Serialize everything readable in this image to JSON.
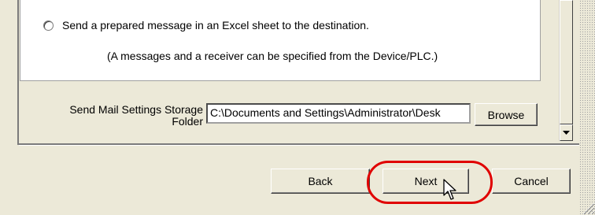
{
  "option": {
    "label": "Send a prepared message in an Excel sheet to the destination.",
    "note": "(A messages and a receiver can be specified from the Device/PLC.)"
  },
  "folder": {
    "label_line1": "Send Mail Settings Storage",
    "label_line2": "Folder",
    "value": "C:\\Documents and Settings\\Administrator\\Desk",
    "browse_label": "Browse"
  },
  "footer": {
    "back_label": "Back",
    "next_label": "Next",
    "cancel_label": "Cancel"
  },
  "colors": {
    "dialog_bg": "#ece9d8",
    "highlight_ring": "#e00000"
  },
  "icons": [
    "radio-button-icon",
    "scroll-down-arrow-icon",
    "mouse-pointer-icon",
    "resize-grip-icon"
  ]
}
